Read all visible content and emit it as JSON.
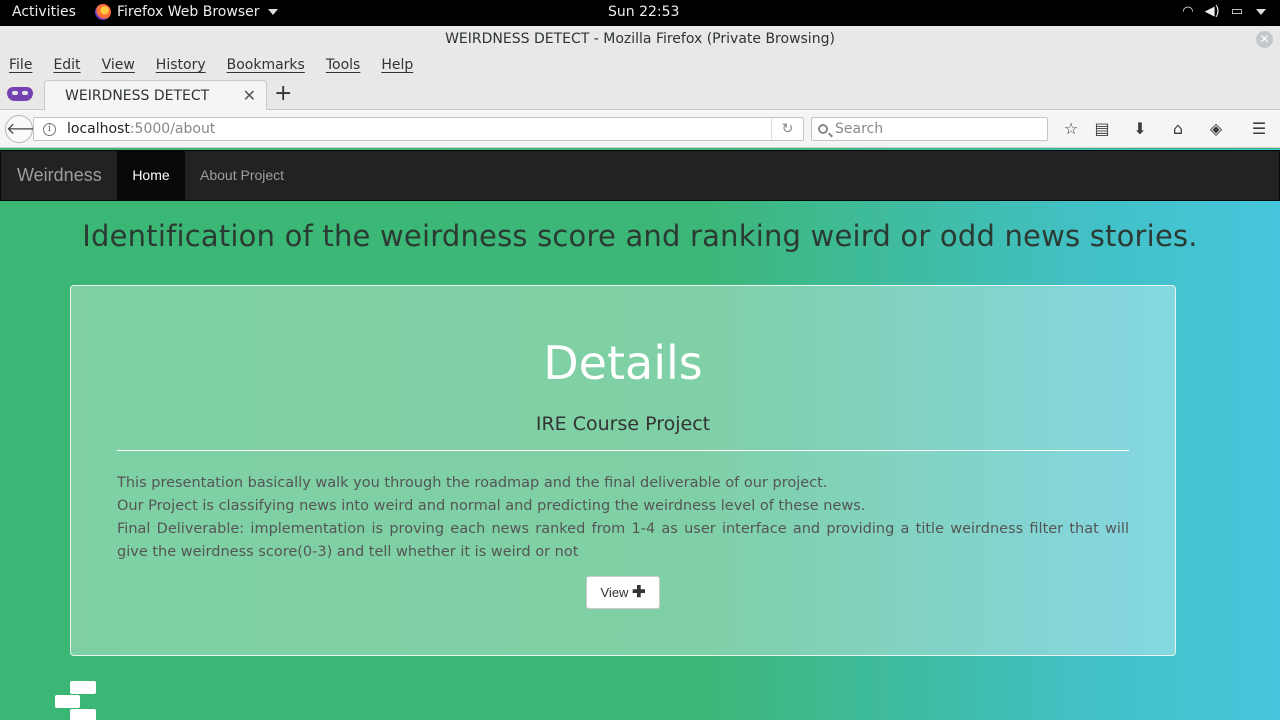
{
  "topbar": {
    "activities": "Activities",
    "app_name": "Firefox Web Browser",
    "clock": "Sun 22:53"
  },
  "window": {
    "title": "WEIRDNESS DETECT - Mozilla Firefox (Private Browsing)"
  },
  "menubar": {
    "items": [
      "File",
      "Edit",
      "View",
      "History",
      "Bookmarks",
      "Tools",
      "Help"
    ]
  },
  "tabs": [
    {
      "label": "WEIRDNESS DETECT"
    }
  ],
  "urlbar": {
    "host": "localhost",
    "path": ":5000/about"
  },
  "searchbar": {
    "placeholder": "Search"
  },
  "site": {
    "brand": "Weirdness",
    "nav": {
      "home": "Home",
      "about": "About Project"
    },
    "headline": "Identification of the weirdness score and ranking weird or odd news stories.",
    "panel": {
      "title": "Details",
      "subtitle": "IRE Course Project",
      "lines": [
        "This presentation basically walk you through the roadmap and the final deliverable of our project.",
        "Our Project is classifying news into weird and normal and predicting the weirdness level of these news.",
        "Final Deliverable: implementation is proving each news ranked from 1-4 as user interface and providing a title weirdness filter that will give the weirdness score(0-3) and tell whether it is weird or not"
      ],
      "button": "View"
    }
  }
}
